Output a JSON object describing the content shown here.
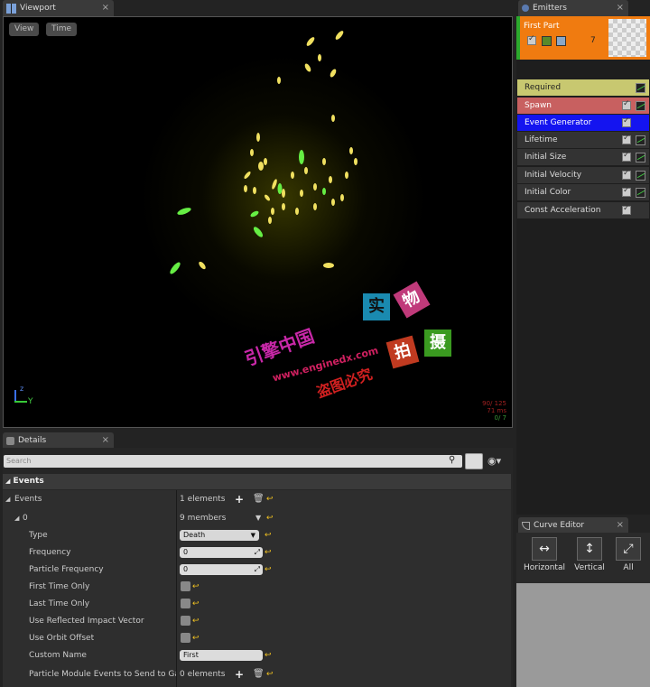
{
  "viewport": {
    "tab_label": "Viewport",
    "view_button": "View",
    "time_button": "Time",
    "stats": [
      "90/ 125",
      "71 ms",
      "0/ 7"
    ],
    "axis_z": "z",
    "axis_y": "Y"
  },
  "emitters": {
    "tab_label": "Emitters",
    "emitter_name": "First Part",
    "emitter_count": "7",
    "modules": [
      {
        "label": "Required"
      },
      {
        "label": "Spawn"
      },
      {
        "label": "Event Generator"
      },
      {
        "label": "Lifetime"
      },
      {
        "label": "Initial Size"
      },
      {
        "label": "Initial Velocity"
      },
      {
        "label": "Initial Color"
      },
      {
        "label": "Const Acceleration"
      }
    ]
  },
  "details": {
    "tab_label": "Details",
    "search_placeholder": "Search",
    "section_title": "Events",
    "events_label": "Events",
    "events_count": "1 elements",
    "index_label": "0",
    "index_members": "9 members",
    "type_label": "Type",
    "type_value": "Death",
    "frequency_label": "Frequency",
    "frequency_value": "0",
    "particle_frequency_label": "Particle Frequency",
    "particle_frequency_value": "0",
    "first_time_only_label": "First Time Only",
    "last_time_only_label": "Last Time Only",
    "use_reflected_label": "Use Reflected Impact Vector",
    "use_orbit_label": "Use Orbit Offset",
    "custom_name_label": "Custom Name",
    "custom_name_value": "First",
    "particle_module_label": "Particle Module Events to Send to Game",
    "particle_module_count": "0 elements"
  },
  "curve_editor": {
    "tab_label": "Curve Editor",
    "horizontal_label": "Horizontal",
    "vertical_label": "Vertical",
    "all_label": "All"
  },
  "watermark": {
    "site": "www.enginedx.com",
    "line1": "引擎中国",
    "line2": "盗图必究",
    "chars": [
      "实",
      "物",
      "拍",
      "摄"
    ]
  }
}
